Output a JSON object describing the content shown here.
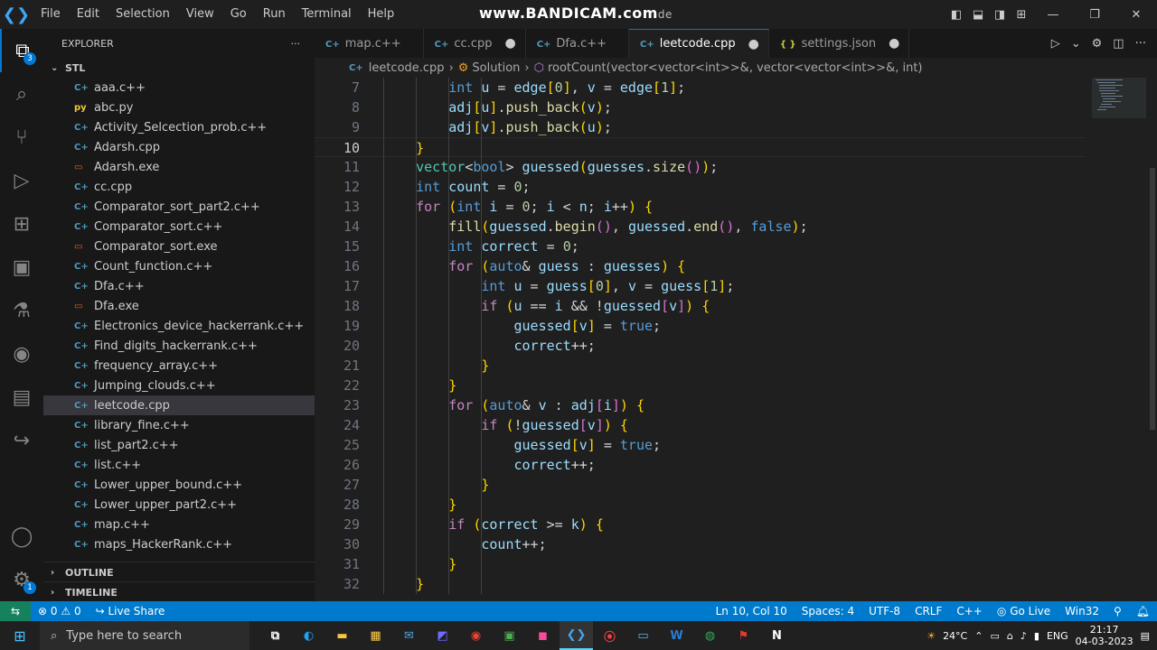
{
  "titlebar": {
    "menu": [
      "File",
      "Edit",
      "Selection",
      "View",
      "Go",
      "Run",
      "Terminal",
      "Help"
    ],
    "watermark": "www.BANDICAM.com",
    "watermark_tail": "de"
  },
  "activity": {
    "explorer_badge": "3",
    "settings_badge": "1"
  },
  "explorer": {
    "title": "EXPLORER",
    "folder": "STL",
    "files": [
      {
        "name": "aaa.c++",
        "icon": "C+"
      },
      {
        "name": "abc.py",
        "icon": "py"
      },
      {
        "name": "Activity_Selcection_prob.c++",
        "icon": "C+"
      },
      {
        "name": "Adarsh.cpp",
        "icon": "C+"
      },
      {
        "name": "Adarsh.exe",
        "icon": "▭"
      },
      {
        "name": "cc.cpp",
        "icon": "C+"
      },
      {
        "name": "Comparator_sort_part2.c++",
        "icon": "C+"
      },
      {
        "name": "Comparator_sort.c++",
        "icon": "C+"
      },
      {
        "name": "Comparator_sort.exe",
        "icon": "▭"
      },
      {
        "name": "Count_function.c++",
        "icon": "C+"
      },
      {
        "name": "Dfa.c++",
        "icon": "C+"
      },
      {
        "name": "Dfa.exe",
        "icon": "▭"
      },
      {
        "name": "Electronics_device_hackerrank.c++",
        "icon": "C+"
      },
      {
        "name": "Find_digits_hackerrank.c++",
        "icon": "C+"
      },
      {
        "name": "frequency_array.c++",
        "icon": "C+"
      },
      {
        "name": "Jumping_clouds.c++",
        "icon": "C+"
      },
      {
        "name": "leetcode.cpp",
        "icon": "C+"
      },
      {
        "name": "library_fine.c++",
        "icon": "C+"
      },
      {
        "name": "list_part2.c++",
        "icon": "C+"
      },
      {
        "name": "list.c++",
        "icon": "C+"
      },
      {
        "name": "Lower_upper_bound.c++",
        "icon": "C+"
      },
      {
        "name": "Lower_upper_part2.c++",
        "icon": "C+"
      },
      {
        "name": "map.c++",
        "icon": "C+"
      },
      {
        "name": "maps_HackerRank.c++",
        "icon": "C+"
      }
    ],
    "outline": "OUTLINE",
    "timeline": "TIMELINE"
  },
  "tabs": [
    {
      "label": "map.c++",
      "icon": "C+",
      "dirty": false
    },
    {
      "label": "cc.cpp",
      "icon": "C+",
      "dirty": true
    },
    {
      "label": "Dfa.c++",
      "icon": "C+",
      "dirty": false
    },
    {
      "label": "leetcode.cpp",
      "icon": "C+",
      "dirty": true
    },
    {
      "label": "settings.json",
      "icon": "{ }",
      "dirty": true
    }
  ],
  "breadcrumb": {
    "file": "leetcode.cpp",
    "class": "Solution",
    "method": "rootCount(vector<vector<int>>&, vector<vector<int>>&, int)"
  },
  "code": {
    "lines": [
      {
        "n": "7",
        "text": "        int u = edge[0], v = edge[1];"
      },
      {
        "n": "8",
        "text": "        adj[u].push_back(v);"
      },
      {
        "n": "9",
        "text": "        adj[v].push_back(u);"
      },
      {
        "n": "10",
        "text": "    }"
      },
      {
        "n": "11",
        "text": "    vector<bool> guessed(guesses.size());"
      },
      {
        "n": "12",
        "text": "    int count = 0;"
      },
      {
        "n": "13",
        "text": "    for (int i = 0; i < n; i++) {"
      },
      {
        "n": "14",
        "text": "        fill(guessed.begin(), guessed.end(), false);"
      },
      {
        "n": "15",
        "text": "        int correct = 0;"
      },
      {
        "n": "16",
        "text": "        for (auto& guess : guesses) {"
      },
      {
        "n": "17",
        "text": "            int u = guess[0], v = guess[1];"
      },
      {
        "n": "18",
        "text": "            if (u == i && !guessed[v]) {"
      },
      {
        "n": "19",
        "text": "                guessed[v] = true;"
      },
      {
        "n": "20",
        "text": "                correct++;"
      },
      {
        "n": "21",
        "text": "            }"
      },
      {
        "n": "22",
        "text": "        }"
      },
      {
        "n": "23",
        "text": "        for (auto& v : adj[i]) {"
      },
      {
        "n": "24",
        "text": "            if (!guessed[v]) {"
      },
      {
        "n": "25",
        "text": "                guessed[v] = true;"
      },
      {
        "n": "26",
        "text": "                correct++;"
      },
      {
        "n": "27",
        "text": "            }"
      },
      {
        "n": "28",
        "text": "        }"
      },
      {
        "n": "29",
        "text": "        if (correct >= k) {"
      },
      {
        "n": "30",
        "text": "            count++;"
      },
      {
        "n": "31",
        "text": "        }"
      },
      {
        "n": "32",
        "text": "    }"
      }
    ],
    "current_line": "10"
  },
  "status": {
    "errors": "0",
    "warnings": "0",
    "live_share": "Live Share",
    "position": "Ln 10, Col 10",
    "spaces": "Spaces: 4",
    "encoding": "UTF-8",
    "eol": "CRLF",
    "language": "C++",
    "go_live": "Go Live",
    "platform": "Win32"
  },
  "taskbar": {
    "search_placeholder": "Type here to search",
    "weather": "24°C",
    "lang": "ENG",
    "time": "21:17",
    "date": "04-03-2023"
  },
  "colors": {
    "accent": "#0078d4",
    "statusbar": "#007acc",
    "remote": "#16825d"
  }
}
